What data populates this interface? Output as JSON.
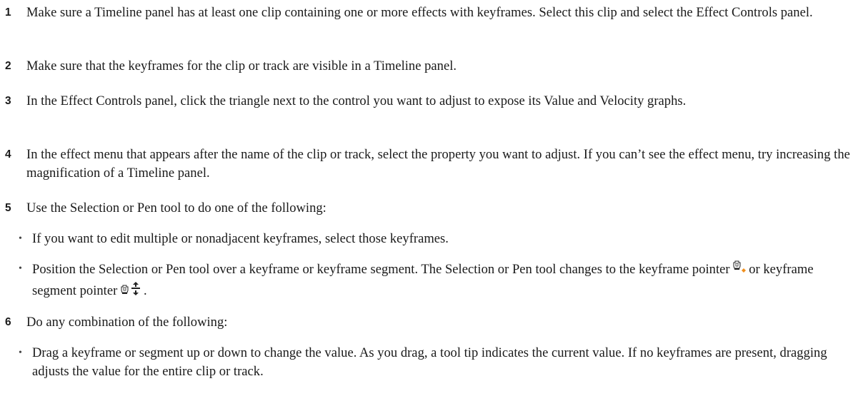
{
  "steps": [
    {
      "num": "1",
      "text": "Make sure a Timeline panel has at least one clip containing one or more effects with keyframes. Select this clip and select the Effect Controls panel."
    },
    {
      "num": "2",
      "text": "Make sure that the keyframes for the clip or track are visible in a Timeline panel."
    },
    {
      "num": "3",
      "text": "In the Effect Controls panel, click the triangle next to the control you want to adjust to expose its Value and Velocity graphs."
    },
    {
      "num": "4",
      "text": "In the effect menu that appears after the name of the clip or track, select the property you want to adjust. If you can’t see the effect menu, try increasing the magnification of a Timeline panel."
    },
    {
      "num": "5",
      "text": "Use the Selection or Pen tool to do one of the following:"
    },
    {
      "num": "6",
      "text": "Do any combination of the following:"
    }
  ],
  "step5_bullets": {
    "b1": "If you want to edit multiple or nonadjacent keyframes, select those keyframes.",
    "b2_part1": "Position the Selection or Pen tool over a keyframe or keyframe segment. The Selection or Pen tool changes to the keyframe pointer ",
    "b2_part2": "or keyframe segment pointer ",
    "b2_part3": "."
  },
  "step6_bullets": {
    "b1": "Drag a keyframe or segment up or down to change the value. As you drag, a tool tip indicates the current value. If no keyframes are present, dragging adjusts the value for the entire clip or track."
  },
  "bullet_glyph": "•",
  "icons": {
    "keyframe_pointer": "keyframe-pointer-icon",
    "segment_pointer": "keyframe-segment-pointer-icon"
  },
  "colors": {
    "text": "#1a1a1a",
    "keyframe_diamond": "#f0901e"
  }
}
